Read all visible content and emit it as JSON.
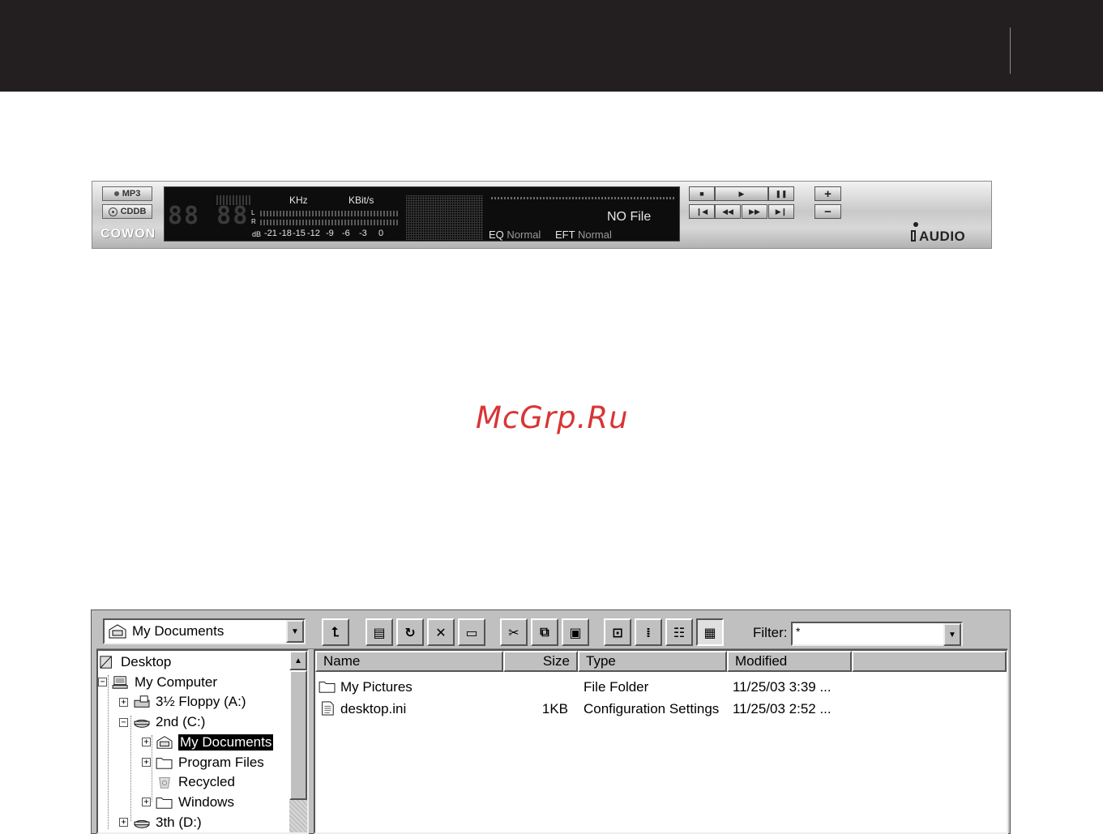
{
  "player": {
    "mode_buttons": {
      "mp3": "MP3",
      "cddb": "CDDB"
    },
    "brand_left": "COWON",
    "time_digits": "88 88",
    "labels": {
      "khz": "KHz",
      "kbits": "KBit/s",
      "left": "L",
      "right": "R",
      "db": "dB"
    },
    "db_scale": [
      "-21",
      "-18",
      "-15",
      "-12",
      "-9",
      "-6",
      "-3",
      "0"
    ],
    "track_title": "NO File",
    "eq_label": "EQ",
    "eq_value": "Normal",
    "eft_label": "EFT",
    "eft_value": "Normal",
    "transport": {
      "top": [
        "■",
        "▶",
        "❚❚"
      ],
      "bottom": [
        "❙◀",
        "◀◀",
        "▶▶",
        "▶❙"
      ]
    },
    "volume": {
      "up": "+",
      "down": "−"
    },
    "brand_right": "AUDIO"
  },
  "watermark": "McGrp.Ru",
  "explorer": {
    "location": "My Documents",
    "filter_label": "Filter:",
    "filter_value": "*",
    "toolbar_icons": [
      "up-folder-icon",
      "properties-icon",
      "refresh-icon",
      "delete-icon",
      "new-folder-icon",
      "cut-icon",
      "copy-icon",
      "paste-icon",
      "large-icons-view-icon",
      "small-icons-view-icon",
      "list-view-icon",
      "details-view-icon"
    ],
    "tree": [
      {
        "label": "Desktop",
        "icon": "desktop-icon",
        "expander": ""
      },
      {
        "label": "My Computer",
        "icon": "computer-icon",
        "expander": "−"
      },
      {
        "label": "3½ Floppy (A:)",
        "icon": "floppy-icon",
        "expander": "+"
      },
      {
        "label": "2nd (C:)",
        "icon": "drive-icon",
        "expander": "−"
      },
      {
        "label": "My Documents",
        "icon": "my-documents-icon",
        "expander": "+"
      },
      {
        "label": "Program Files",
        "icon": "folder-icon",
        "expander": "+"
      },
      {
        "label": "Recycled",
        "icon": "recycle-bin-icon",
        "expander": ""
      },
      {
        "label": "Windows",
        "icon": "folder-icon",
        "expander": "+"
      },
      {
        "label": "3th (D:)",
        "icon": "drive-icon",
        "expander": "+"
      }
    ],
    "columns": {
      "name": "Name",
      "size": "Size",
      "type": "Type",
      "modified": "Modified"
    },
    "files": [
      {
        "name": "My Pictures",
        "size": "",
        "type": "File Folder",
        "modified": "11/25/03 3:39 ...",
        "icon": "folder-icon"
      },
      {
        "name": "desktop.ini",
        "size": "1KB",
        "type": "Configuration Settings",
        "modified": "11/25/03 2:52 ...",
        "icon": "text-file-icon"
      }
    ]
  }
}
